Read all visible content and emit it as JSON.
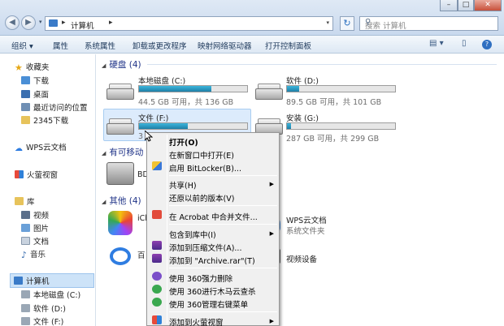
{
  "address": {
    "crumb": "计算机",
    "sep": "▸"
  },
  "search": {
    "placeholder": "搜索 计算机"
  },
  "toolbar": {
    "organize": "组织 ▾",
    "properties": "属性",
    "system_properties": "系统属性",
    "uninstall": "卸载或更改程序",
    "map_drive": "映射网络驱动器",
    "control_panel": "打开控制面板"
  },
  "sidebar": {
    "favorites": "收藏夹",
    "downloads": "下载",
    "desktop": "桌面",
    "recent": "最近访问的位置",
    "dl2345": "2345下载",
    "wps_cloud": "WPS云文档",
    "huorong": "火萤视窗",
    "libraries": "库",
    "videos": "视频",
    "pictures": "图片",
    "documents": "文档",
    "music": "音乐",
    "computer": "计算机",
    "drive_c": "本地磁盘 (C:)",
    "drive_d": "软件 (D:)",
    "drive_f": "文件 (F:)"
  },
  "groups": {
    "hard_disks": "硬盘 (4)",
    "removable": "有可移动",
    "other": "其他 (4)"
  },
  "drives": [
    {
      "name": "本地磁盘 (C:)",
      "free": "44.5 GB 可用，共 136 GB",
      "used_fraction": 0.67
    },
    {
      "name": "软件 (D:)",
      "free": "89.5 GB 可用，共 101 GB",
      "used_fraction": 0.11
    },
    {
      "name": "文件 (F:)",
      "free": "3",
      "used_fraction": 0.45
    },
    {
      "name": "安装 (G:)",
      "free": "287 GB 可用，共 299 GB",
      "used_fraction": 0.04
    }
  ],
  "removable_items": [
    {
      "label": "BD"
    }
  ],
  "other_items": [
    {
      "label": "iCl"
    },
    {
      "label": "WPS云文档",
      "sub": "系统文件夹"
    },
    {
      "label": "百"
    },
    {
      "label": "视频设备"
    }
  ],
  "menu": [
    {
      "label": "打开(O)",
      "bold": true
    },
    {
      "label": "在新窗口中打开(E)"
    },
    {
      "label": "启用 BitLocker(B)..."
    },
    {
      "label": "共享(H)",
      "submenu": true
    },
    {
      "label": "还原以前的版本(V)"
    },
    {
      "label": "在 Acrobat 中合并文件..."
    },
    {
      "label": "包含到库中(I)",
      "submenu": true
    },
    {
      "label": "添加到压缩文件(A)..."
    },
    {
      "label": "添加到 \"Archive.rar\"(T)"
    },
    {
      "label": "使用 360强力删除"
    },
    {
      "label": "使用 360进行木马云查杀"
    },
    {
      "label": "使用 360管理右键菜单"
    },
    {
      "label": "添加到火萤视窗",
      "submenu": true
    }
  ]
}
